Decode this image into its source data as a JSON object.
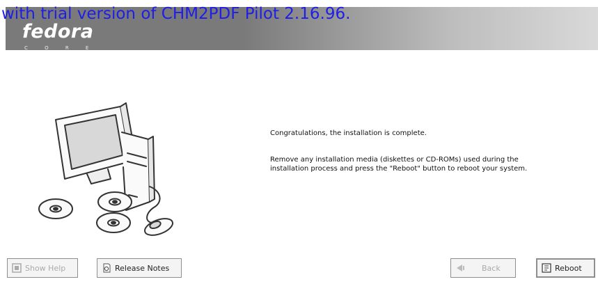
{
  "watermark": "with trial version of CHM2PDF Pilot 2.16.96.",
  "header": {
    "logo_text": "fedora",
    "logo_subtext": "C O R E"
  },
  "illustration": {
    "icon": "computer-with-discs-icon"
  },
  "message": {
    "line1": "Congratulations, the installation is complete.",
    "line2": "Remove any installation media (diskettes or CD-ROMs) used during the installation process and press the \"Reboot\" button to reboot your system."
  },
  "buttons": {
    "show_help": {
      "label": "Show Help",
      "icon": "help-icon",
      "disabled": true
    },
    "release_notes": {
      "label": "Release Notes",
      "icon": "notes-icon",
      "disabled": false
    },
    "back": {
      "label": "Back",
      "icon": "back-arrow-icon",
      "disabled": true
    },
    "reboot": {
      "label": "Reboot",
      "icon": "reboot-icon",
      "disabled": false
    }
  }
}
